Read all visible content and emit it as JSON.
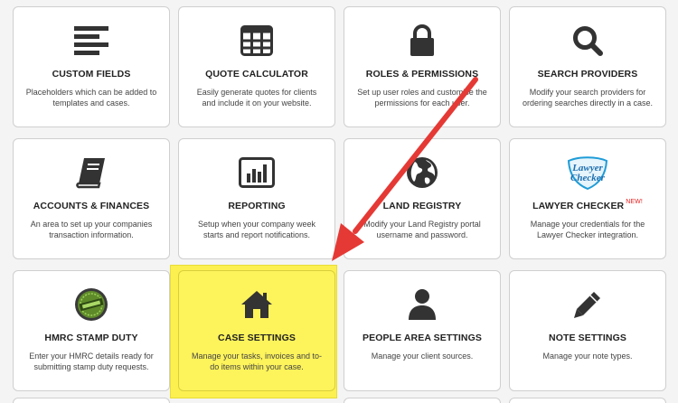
{
  "cards": [
    {
      "title": "CUSTOM FIELDS",
      "desc": "Placeholders which can be added to templates and cases.",
      "icon": "list-icon"
    },
    {
      "title": "QUOTE CALCULATOR",
      "desc": "Easily generate quotes for clients and include it on your website.",
      "icon": "table-icon"
    },
    {
      "title": "ROLES & PERMISSIONS",
      "desc": "Set up user roles and customise the permissions for each user.",
      "icon": "lock-icon"
    },
    {
      "title": "SEARCH PROVIDERS",
      "desc": "Modify your search providers for ordering searches directly in a case.",
      "icon": "search-icon"
    },
    {
      "title": "ACCOUNTS & FINANCES",
      "desc": "An area to set up your companies transaction information.",
      "icon": "book-icon"
    },
    {
      "title": "REPORTING",
      "desc": "Setup when your company week starts and report notifications.",
      "icon": "bar-chart-icon"
    },
    {
      "title": "LAND REGISTRY",
      "desc": "Modify your Land Registry portal username and password.",
      "icon": "globe-icon"
    },
    {
      "title": "LAWYER CHECKER",
      "badge": "NEW!",
      "desc": "Manage your credentials for the Lawyer Checker integration.",
      "icon": "lawyer-checker-logo",
      "logo_text_1": "Lawyer",
      "logo_text_2": "Checker"
    },
    {
      "title": "HMRC STAMP DUTY",
      "desc": "Enter your HMRC details ready for submitting stamp duty requests.",
      "icon": "stamp-icon"
    },
    {
      "title": "CASE SETTINGS",
      "desc": "Manage your tasks, invoices and to-do items within your case.",
      "icon": "home-icon"
    },
    {
      "title": "PEOPLE AREA SETTINGS",
      "desc": "Manage your client sources.",
      "icon": "person-icon"
    },
    {
      "title": "NOTE SETTINGS",
      "desc": "Manage your note types.",
      "icon": "pencil-icon"
    }
  ],
  "colors": {
    "highlight": "#fcf050",
    "arrow": "#e53935",
    "icon": "#333333"
  }
}
